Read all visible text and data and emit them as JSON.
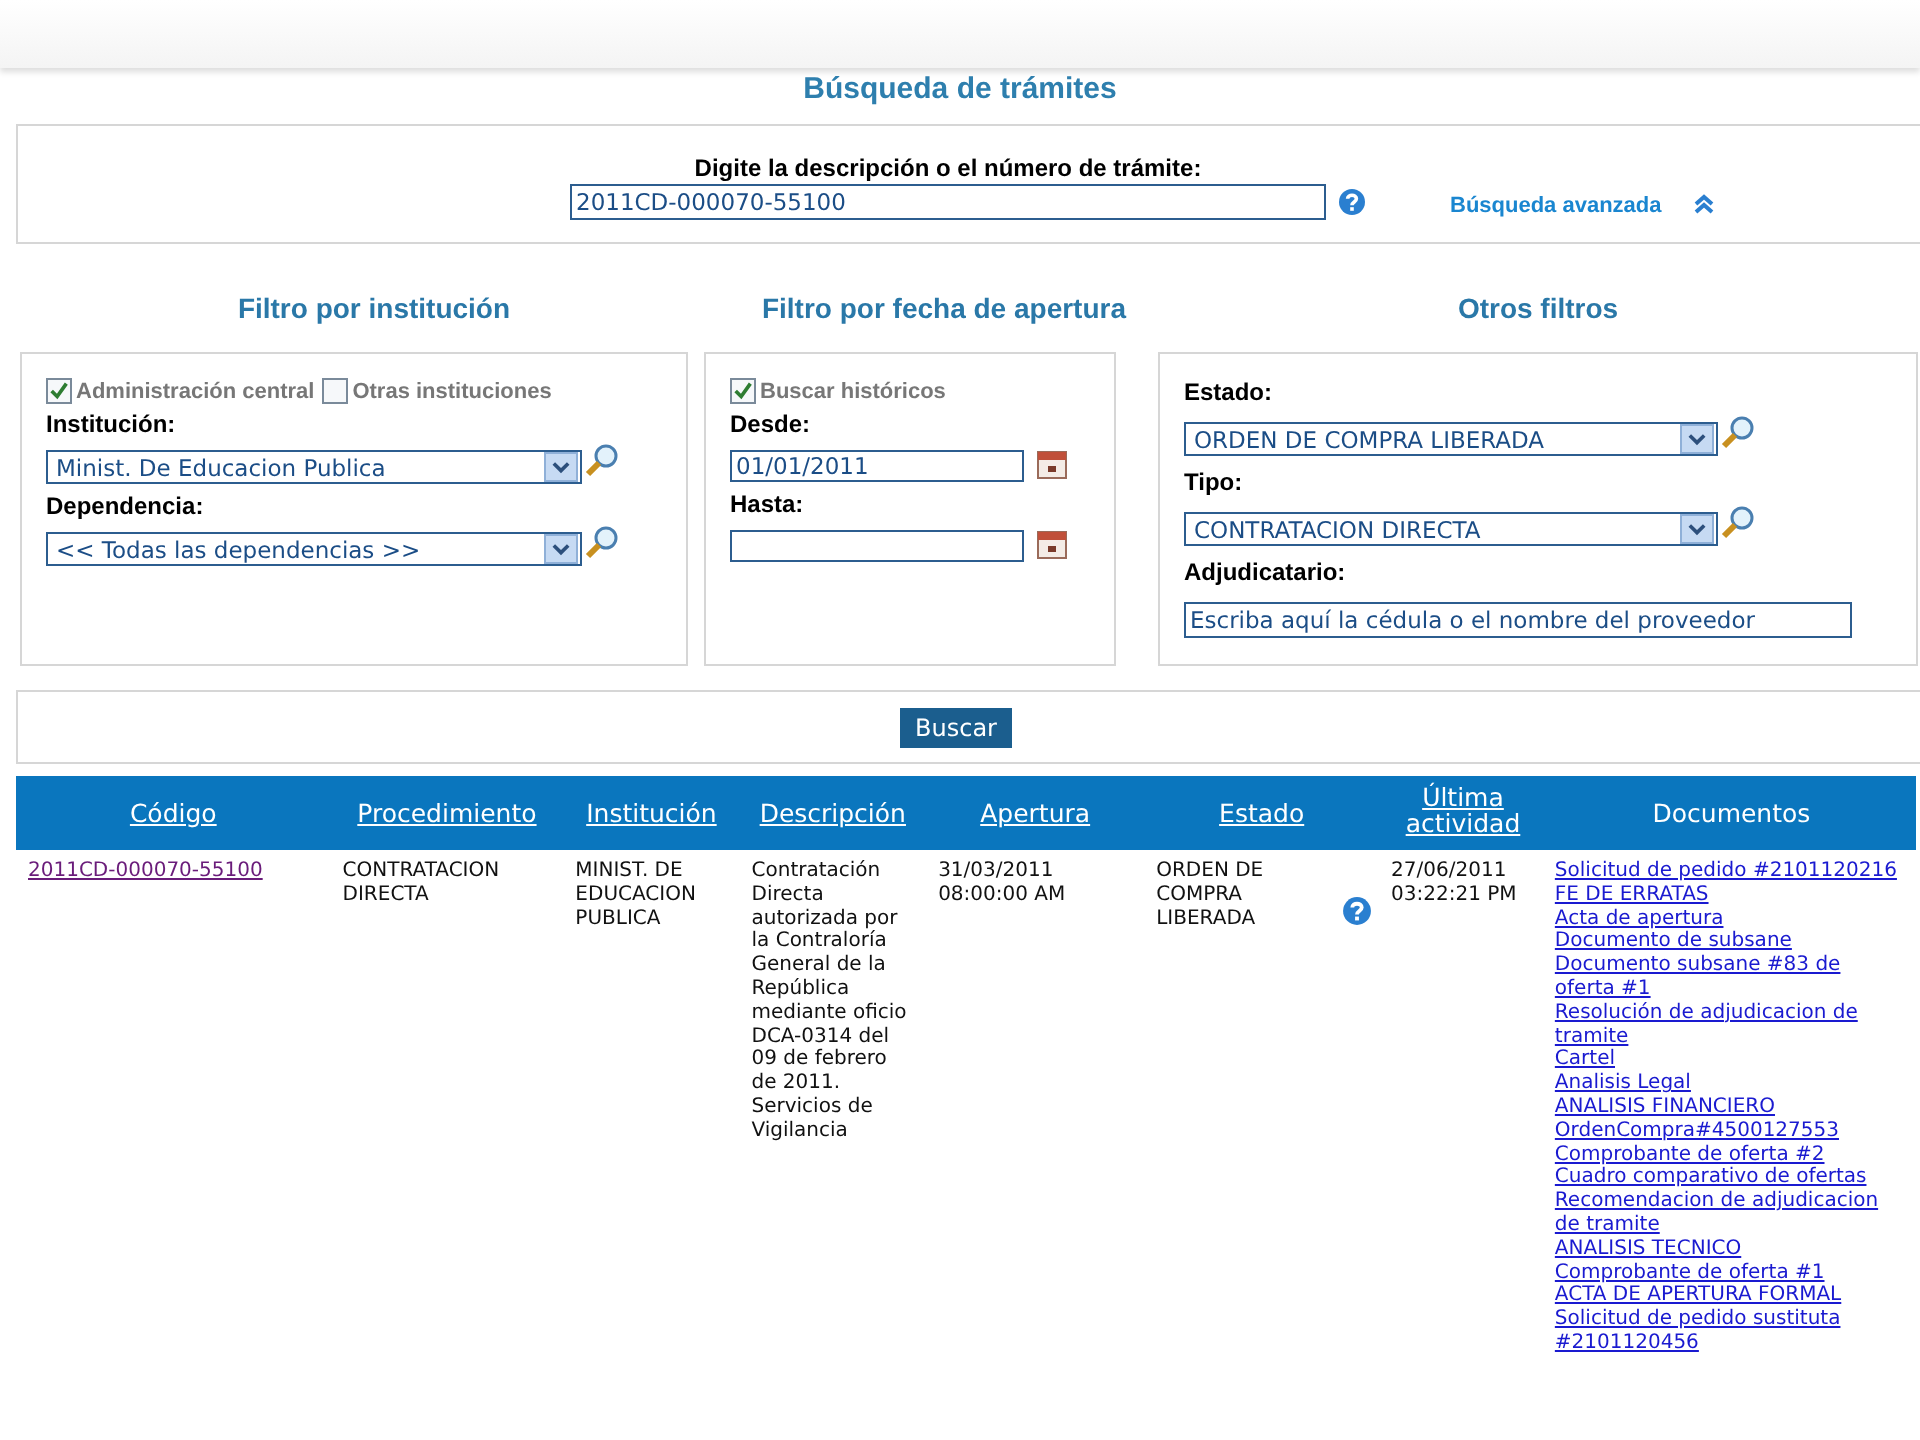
{
  "title": "Búsqueda de trámites",
  "search": {
    "label": "Digite la descripción o el número de trámite:",
    "value": "2011CD-000070-55100",
    "advanced_link": "Búsqueda avanzada"
  },
  "filters": [
    {
      "heading": "Filtro por institución",
      "checkboxes": [
        {
          "label": "Administración central",
          "checked": true
        },
        {
          "label": "Otras instituciones",
          "checked": false
        }
      ],
      "fields": [
        {
          "kind": "select",
          "label": "Institución:",
          "value": "Minist. De Educacion Publica"
        },
        {
          "kind": "select",
          "label": "Dependencia:",
          "value": "<< Todas las dependencias >>"
        }
      ]
    },
    {
      "heading": "Filtro por fecha de apertura",
      "checkboxes": [
        {
          "label": "Buscar históricos",
          "checked": true
        }
      ],
      "fields": [
        {
          "kind": "date",
          "label": "Desde:",
          "value": "01/01/2011"
        },
        {
          "kind": "date",
          "label": "Hasta:"
        }
      ]
    },
    {
      "heading": "Otros filtros",
      "fields": [
        {
          "kind": "select",
          "label": "Estado:",
          "value": "ORDEN DE COMPRA LIBERADA"
        },
        {
          "kind": "select",
          "label": "Tipo:",
          "value": "CONTRATACION DIRECTA"
        },
        {
          "kind": "text",
          "label": "Adjudicatario:",
          "placeholder": "Escriba aquí la cédula o el nombre del proveedor"
        }
      ]
    }
  ],
  "search_button": "Buscar",
  "table": {
    "columns": [
      {
        "label": "Código",
        "kind": "link"
      },
      {
        "label": "Procedimiento",
        "kind": "link"
      },
      {
        "label": "Institución",
        "kind": "link"
      },
      {
        "label": "Descripción",
        "kind": "link"
      },
      {
        "label": "Apertura",
        "kind": "link"
      },
      {
        "label": "Estado",
        "kind": "link"
      },
      {
        "label": "Última actividad",
        "kind": "link"
      },
      {
        "label": "Documentos",
        "kind": "text"
      }
    ],
    "rows": [
      {
        "cells": [
          {
            "kind": "link",
            "text": "2011CD-000070-55100"
          },
          {
            "kind": "text",
            "text": "CONTRATACION DIRECTA"
          },
          {
            "kind": "text",
            "text": "MINIST. DE EDUCACION PUBLICA"
          },
          {
            "kind": "text",
            "text": "Contratación Directa autorizada por la Contraloría General de la República mediante oficio DCA-0314 del 09 de febrero de 2011. Servicios de Vigilancia"
          },
          {
            "kind": "text",
            "text": "31/03/2011 08:00:00 AM"
          },
          {
            "kind": "status",
            "text": "ORDEN DE COMPRA LIBERADA"
          },
          {
            "kind": "text",
            "text": "27/06/2011 03:22:21 PM"
          }
        ],
        "documents": [
          "Solicitud de pedido #2101120216",
          "FE DE ERRATAS",
          "Acta de apertura",
          "Documento de subsane",
          "Documento subsane #83 de oferta #1",
          "Resolución de adjudicacion de tramite",
          "Cartel",
          "Analisis Legal",
          "ANALISIS FINANCIERO",
          "OrdenCompra#4500127553",
          "Comprobante de oferta #2",
          "Cuadro comparativo de ofertas",
          "Recomendacion de adjudicacion de tramite",
          "ANALISIS TECNICO",
          "Comprobante de oferta #1",
          "ACTA DE APERTURA FORMAL",
          "Solicitud de pedido sustituta #2101120456"
        ]
      }
    ]
  }
}
